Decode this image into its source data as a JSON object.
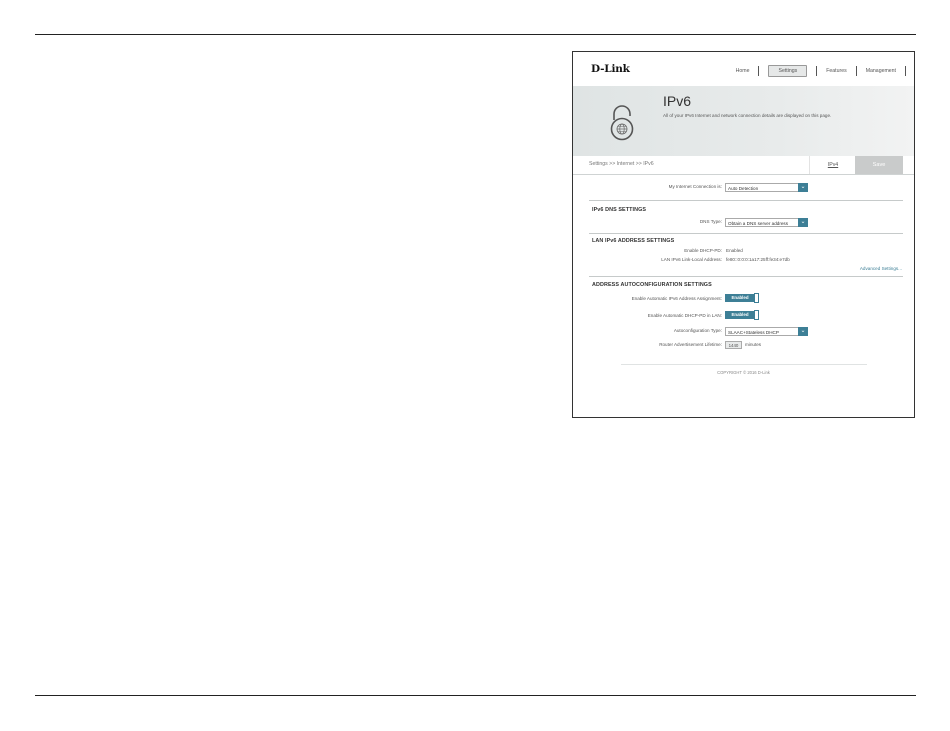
{
  "header": {
    "logo": "D-Link",
    "nav": [
      "Home",
      "Settings",
      "Features",
      "Management"
    ],
    "active_nav": "Settings"
  },
  "hero": {
    "title": "IPv6",
    "description": "All of your IPv6 Internet and network connection details are displayed on this page.",
    "icon": "lock-globe-icon"
  },
  "subbar": {
    "breadcrumb": "Settings >> Internet >> IPv6",
    "ipv4_tab": "IPv4",
    "save_label": "Save"
  },
  "connection": {
    "label": "My Internet Connection is:",
    "value": "Auto Detection"
  },
  "dns": {
    "title": "IPv6 DNS SETTINGS",
    "type_label": "DNS Type:",
    "type_value": "Obtain a DNS server address"
  },
  "lan": {
    "title": "LAN IPv6 ADDRESS SETTINGS",
    "dhcp_pd_label": "Enable DHCP-PD:",
    "dhcp_pd_value": "Enabled",
    "link_local_label": "LAN IPv6 Link-Local Address:",
    "link_local_value": "fe80::0:0:0:1a17:25ff:fe34:e7db",
    "advanced_link": "Advanced Settings..."
  },
  "autoconfig": {
    "title": "ADDRESS AUTOCONFIGURATION SETTINGS",
    "auto_assign_label": "Enable Automatic IPv6 Address Assignment:",
    "auto_assign_value": "Enabled",
    "auto_pd_label": "Enable Automatic DHCP-PD in LAN:",
    "auto_pd_value": "Enabled",
    "type_label": "Autoconfiguration Type:",
    "type_value": "SLAAC+Stateless DHCP",
    "lifetime_label": "Router Advertisement Lifetime:",
    "lifetime_value": "1440",
    "lifetime_unit": "minutes"
  },
  "footer": {
    "copyright": "COPYRIGHT © 2016 D-Link"
  },
  "colors": {
    "accent": "#3d7f96",
    "save_bg": "#c9cbcb"
  }
}
